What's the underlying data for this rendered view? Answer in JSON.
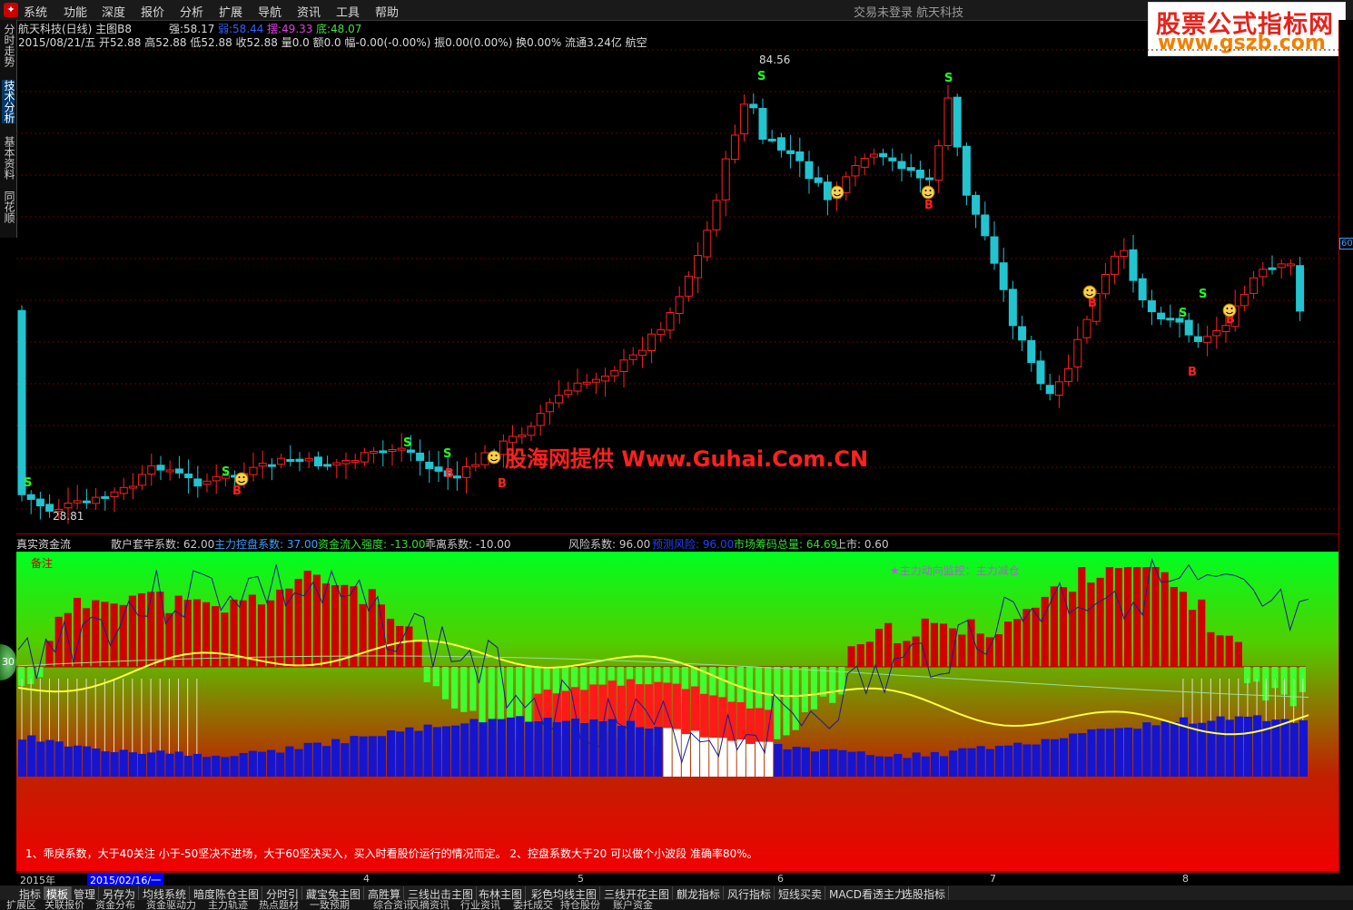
{
  "menu": [
    "系统",
    "功能",
    "深度",
    "报价",
    "分析",
    "扩展",
    "导航",
    "资讯",
    "工具",
    "帮助"
  ],
  "status_text": "交易未登录   航天科技",
  "watermark_top": {
    "line1": "股票公式指标网",
    "line2": "www.gszb.com"
  },
  "side_tabs": [
    "分时走势",
    "技术分析",
    "基本资料",
    "同花顺"
  ],
  "header": {
    "title": "航天科技(日线) 主图B8",
    "qiang_label": "强:",
    "qiang": "58.17",
    "ruo_label": "弱:",
    "ruo": "58.44",
    "bai_label": "摆:",
    "bai": "49.33",
    "di_label": "底:",
    "di": "48.07",
    "quote": "2015/08/21/五 开52.88 高52.88 低52.88 收52.88 量0.0 额0.0 幅-0.00(-0.00%) 振0.00(0.00%) 换0.00% 流通3.24亿 航空"
  },
  "price_labels": {
    "high": "84.56",
    "low": "28.81",
    "axis_badge": "60"
  },
  "watermark_mid": "股海网提供 Www.Guhai.Com.CN",
  "signals": {
    "s": "S",
    "b": "B"
  },
  "sub_header": {
    "name": "真实资金流",
    "items": [
      {
        "label": "散户套牢系数: ",
        "value": "62.00",
        "color": "#c8c8c8"
      },
      {
        "label": "主力控盘系数: ",
        "value": "37.00",
        "color": "#3aa0ff"
      },
      {
        "label": "资金流入强度: ",
        "value": "-13.00",
        "color": "#2ee02e"
      },
      {
        "label": "乖离系数: ",
        "value": "-10.00",
        "color": "#c8c8c8"
      },
      {
        "label": "风险系数: ",
        "value": "96.00",
        "color": "#c8c8c8"
      },
      {
        "label": "预测风险: ",
        "value": "96.00",
        "color": "#2040ff"
      },
      {
        "label": "市场筹码总量: ",
        "value": "64.69",
        "color": "#2ee02e"
      },
      {
        "label": "上市: ",
        "value": "0.60",
        "color": "#c8c8c8"
      }
    ]
  },
  "sub_note": "备注",
  "sub_alert": "★主力动向监控：主力减仓",
  "circle_badge": "30",
  "description": "1、乖戾系数，大于40关注 小于-50坚决不进场，大于60坚决买入，买入时看股价运行的情况而定。      2、控盘系数大于20 可以做个小波段 准确率80%。",
  "date_axis": {
    "year": "2015年",
    "cursor": "2015/02/16/一",
    "months": [
      "4",
      "5",
      "6",
      "7",
      "8"
    ]
  },
  "indicator_tabs": [
    "指标",
    "模板",
    "管理",
    "另存为",
    "均线系统",
    "暗度陈仓主图",
    "分时引",
    "藏宝兔主图",
    "高胜算",
    "三线出击主图",
    "布林主图",
    "彩色均线主图",
    "三线开花主图",
    "麒龙指标",
    "风行指标",
    "短线买卖",
    "MACD看透主力",
    "选股指标"
  ],
  "bottom_tabs": [
    "扩展区",
    "关联报价",
    "资金分布",
    "资金驱动力",
    "主力轨迹",
    "热点题材",
    "一致预期",
    "综合资讯",
    "风摘资讯",
    "行业资讯",
    "委托成交",
    "持仓股份",
    "账户资金"
  ],
  "colors": {
    "up": "#ff2020",
    "down": "#22c4d0",
    "grid": "#6a0000",
    "yellow": "#ffff40",
    "navy": "#1a1a9a"
  }
}
